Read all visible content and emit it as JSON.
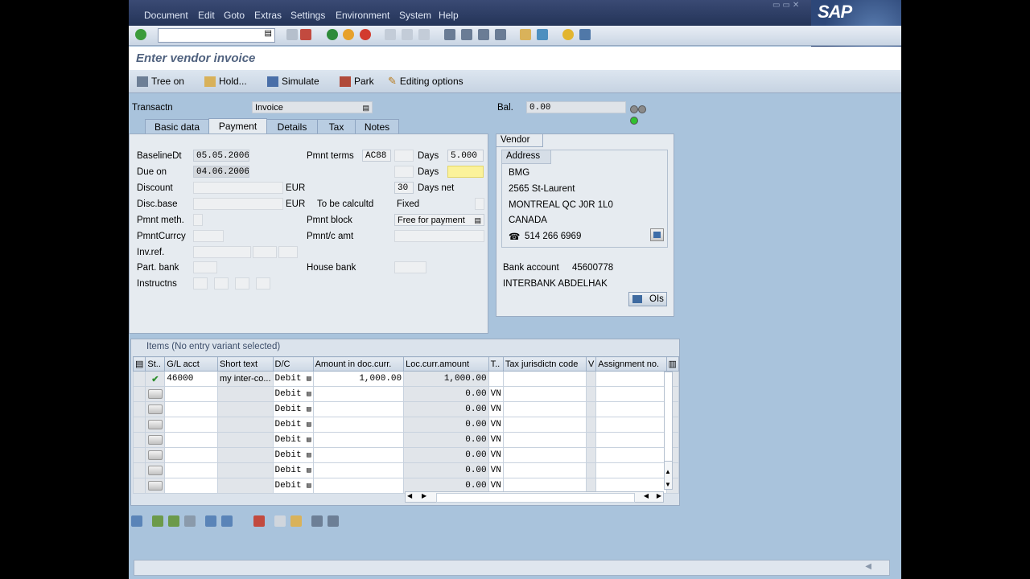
{
  "menu": [
    "Document",
    "Edit",
    "Goto",
    "Extras",
    "Settings",
    "Environment",
    "System",
    "Help"
  ],
  "brand": "SAP",
  "window_title": "Enter vendor invoice",
  "app_toolbar": {
    "tree_on": "Tree on",
    "hold": "Hold...",
    "simulate": "Simulate",
    "park": "Park",
    "editing_options": "Editing options"
  },
  "header": {
    "transactn_label": "Transactn",
    "transactn_value": "Invoice",
    "bal_label": "Bal.",
    "bal_value": "0.00"
  },
  "tabs": [
    "Basic data",
    "Payment",
    "Details",
    "Tax",
    "Notes"
  ],
  "active_tab": "Payment",
  "payment": {
    "baselinedt_label": "BaselineDt",
    "baselinedt_value": "05.05.2006",
    "dueon_label": "Due on",
    "dueon_value": "04.06.2006",
    "discount_label": "Discount",
    "discount_currency": "EUR",
    "discbase_label": "Disc.base",
    "discbase_currency": "EUR",
    "pmntmeth_label": "Pmnt meth.",
    "pmntcurrcy_label": "PmntCurrcy",
    "invref_label": "Inv.ref.",
    "partbank_label": "Part. bank",
    "instructns_label": "Instructns",
    "pmntterms_label": "Pmnt terms",
    "pmntterms_value": "AC88",
    "days1_label": "Days",
    "days1_value": "5.000",
    "days2_label": "Days",
    "days_net_value": "30",
    "days_net_label": "Days net",
    "to_be_calc_label": "To be calcultd",
    "fixed_label": "Fixed",
    "pmntblock_label": "Pmnt block",
    "pmntblock_value": "Free for payment",
    "pmntc_amt_label": "Pmnt/c amt",
    "house_bank_label": "House bank"
  },
  "vendor": {
    "tab_label": "Vendor",
    "address_label": "Address",
    "name": "BMG",
    "street": "2565 St-Laurent",
    "city": "MONTREAL QC  J0R 1L0",
    "country": "CANADA",
    "phone": "514 266 6969",
    "bank_account_label": "Bank account",
    "bank_account_value": "45600778",
    "bank_name": "INTERBANK ABDELHAK",
    "ois_button": "OIs"
  },
  "items": {
    "caption": "Items (No entry variant selected)",
    "columns": [
      "St..",
      "G/L acct",
      "Short text",
      "D/C",
      "Amount in doc.curr.",
      "Loc.curr.amount",
      "T..",
      "Tax jurisdictn code",
      "V",
      "Assignment no."
    ],
    "rows": [
      {
        "gl": "46000",
        "text": "my inter-co...",
        "dc": "Debit",
        "amount": "1,000.00",
        "loc": "1,000.00",
        "t": ""
      },
      {
        "gl": "",
        "text": "",
        "dc": "Debit",
        "amount": "",
        "loc": "0.00",
        "t": "VN"
      },
      {
        "gl": "",
        "text": "",
        "dc": "Debit",
        "amount": "",
        "loc": "0.00",
        "t": "VN"
      },
      {
        "gl": "",
        "text": "",
        "dc": "Debit",
        "amount": "",
        "loc": "0.00",
        "t": "VN"
      },
      {
        "gl": "",
        "text": "",
        "dc": "Debit",
        "amount": "",
        "loc": "0.00",
        "t": "VN"
      },
      {
        "gl": "",
        "text": "",
        "dc": "Debit",
        "amount": "",
        "loc": "0.00",
        "t": "VN"
      },
      {
        "gl": "",
        "text": "",
        "dc": "Debit",
        "amount": "",
        "loc": "0.00",
        "t": "VN"
      },
      {
        "gl": "",
        "text": "",
        "dc": "Debit",
        "amount": "",
        "loc": "0.00",
        "t": "VN"
      }
    ]
  },
  "colors": {
    "accent": "#50627f",
    "background": "#a9c3dc",
    "panel": "#e6ebf0",
    "highlight": "#fbf29a"
  }
}
